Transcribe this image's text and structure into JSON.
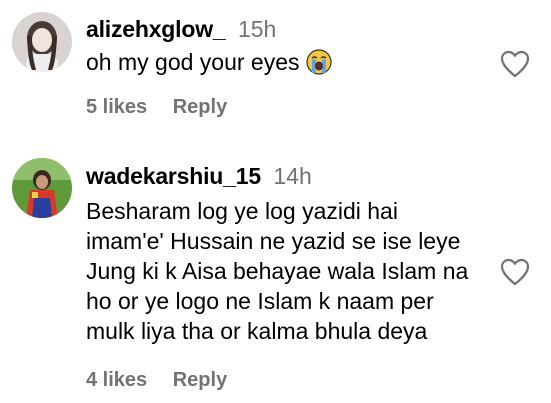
{
  "comments": [
    {
      "username": "alizehxglow_",
      "time": "15h",
      "lines": [
        "oh my god your eyes"
      ],
      "emoji": "loudly-crying-face-emoji",
      "likes": "5 likes",
      "reply": "Reply",
      "avatar": "profile-photo-avatar",
      "like_icon": "heart-outline-icon"
    },
    {
      "username": "wadekarshiu_15",
      "time": "14h",
      "lines": [
        "Besharam log ye log yazidi hai",
        "imam'e' Hussain ne yazid se ise leye",
        "Jung ki k Aisa behayae wala Islam na",
        "ho or ye logo ne Islam k naam per",
        "mulk liya tha or kalma bhula deya"
      ],
      "likes": "4 likes",
      "reply": "Reply",
      "avatar": "profile-photo-avatar",
      "like_icon": "heart-outline-icon"
    }
  ],
  "colors": {
    "text": "#000000",
    "secondary": "#737373",
    "background": "#ffffff"
  }
}
